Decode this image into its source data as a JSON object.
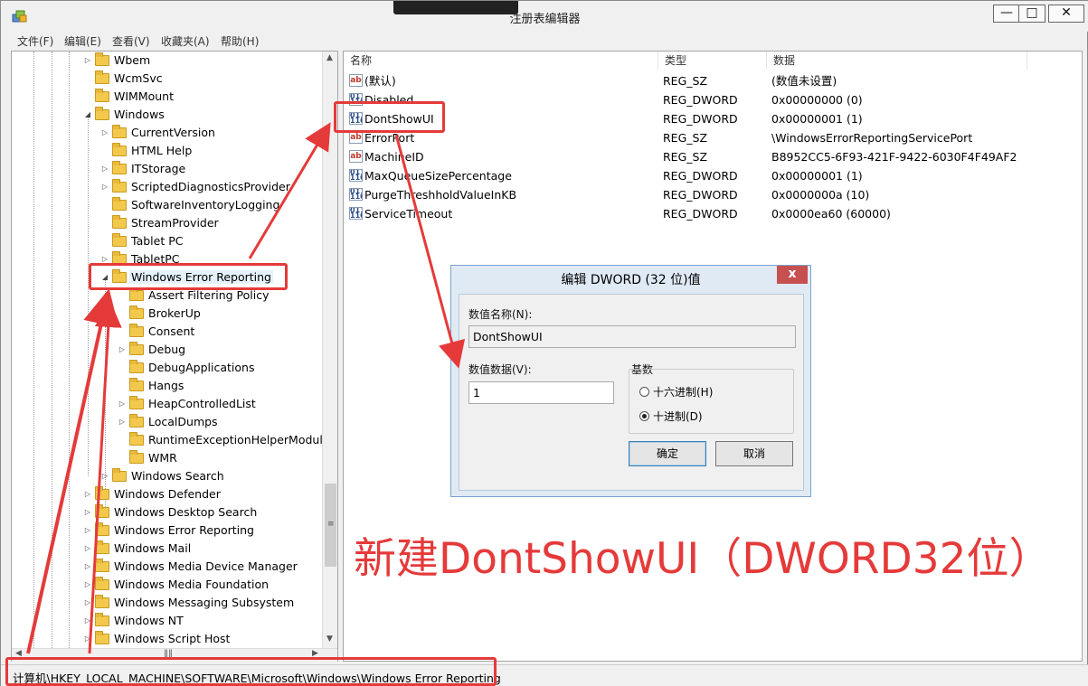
{
  "window": {
    "title": "注册表编辑器"
  },
  "menu": [
    "文件(F)",
    "编辑(E)",
    "查看(V)",
    "收藏夹(A)",
    "帮助(H)"
  ],
  "tree": [
    {
      "label": "Wbem",
      "depth": 1,
      "expander": "collapsed"
    },
    {
      "label": "WcmSvc",
      "depth": 1,
      "expander": "none"
    },
    {
      "label": "WIMMount",
      "depth": 1,
      "expander": "none"
    },
    {
      "label": "Windows",
      "depth": 1,
      "expander": "expanded"
    },
    {
      "label": "CurrentVersion",
      "depth": 2,
      "expander": "collapsed"
    },
    {
      "label": "HTML Help",
      "depth": 2,
      "expander": "none"
    },
    {
      "label": "ITStorage",
      "depth": 2,
      "expander": "collapsed"
    },
    {
      "label": "ScriptedDiagnosticsProvider",
      "depth": 2,
      "expander": "collapsed"
    },
    {
      "label": "SoftwareInventoryLogging",
      "depth": 2,
      "expander": "none"
    },
    {
      "label": "StreamProvider",
      "depth": 2,
      "expander": "none"
    },
    {
      "label": "Tablet PC",
      "depth": 2,
      "expander": "none"
    },
    {
      "label": "TabletPC",
      "depth": 2,
      "expander": "collapsed"
    },
    {
      "label": "Windows Error Reporting",
      "depth": 2,
      "expander": "expanded",
      "selected": true
    },
    {
      "label": "Assert Filtering Policy",
      "depth": 3,
      "expander": "none"
    },
    {
      "label": "BrokerUp",
      "depth": 3,
      "expander": "none"
    },
    {
      "label": "Consent",
      "depth": 3,
      "expander": "none"
    },
    {
      "label": "Debug",
      "depth": 3,
      "expander": "collapsed"
    },
    {
      "label": "DebugApplications",
      "depth": 3,
      "expander": "none"
    },
    {
      "label": "Hangs",
      "depth": 3,
      "expander": "none"
    },
    {
      "label": "HeapControlledList",
      "depth": 3,
      "expander": "collapsed"
    },
    {
      "label": "LocalDumps",
      "depth": 3,
      "expander": "collapsed"
    },
    {
      "label": "RuntimeExceptionHelperModules",
      "depth": 3,
      "expander": "none"
    },
    {
      "label": "WMR",
      "depth": 3,
      "expander": "none"
    },
    {
      "label": "Windows Search",
      "depth": 2,
      "expander": "collapsed"
    },
    {
      "label": "Windows Defender",
      "depth": 1,
      "expander": "collapsed"
    },
    {
      "label": "Windows Desktop Search",
      "depth": 1,
      "expander": "collapsed"
    },
    {
      "label": "Windows Error Reporting",
      "depth": 1,
      "expander": "collapsed"
    },
    {
      "label": "Windows Mail",
      "depth": 1,
      "expander": "collapsed"
    },
    {
      "label": "Windows Media Device Manager",
      "depth": 1,
      "expander": "collapsed"
    },
    {
      "label": "Windows Media Foundation",
      "depth": 1,
      "expander": "collapsed"
    },
    {
      "label": "Windows Messaging Subsystem",
      "depth": 1,
      "expander": "collapsed"
    },
    {
      "label": "Windows NT",
      "depth": 1,
      "expander": "collapsed"
    },
    {
      "label": "Windows Script Host",
      "depth": 1,
      "expander": "collapsed"
    }
  ],
  "columns": {
    "name": "名称",
    "type": "类型",
    "data": "数据"
  },
  "values": [
    {
      "icon": "ab",
      "name": "(默认)",
      "type": "REG_SZ",
      "data": "(数值未设置)"
    },
    {
      "icon": "bin",
      "name": "Disabled",
      "type": "REG_DWORD",
      "data": "0x00000000 (0)"
    },
    {
      "icon": "bin",
      "name": "DontShowUI",
      "type": "REG_DWORD",
      "data": "0x00000001 (1)"
    },
    {
      "icon": "ab",
      "name": "ErrorPort",
      "type": "REG_SZ",
      "data": "\\WindowsErrorReportingServicePort"
    },
    {
      "icon": "ab",
      "name": "MachineID",
      "type": "REG_SZ",
      "data": "B8952CC5-6F93-421F-9422-6030F4F49AF2"
    },
    {
      "icon": "bin",
      "name": "MaxQueueSizePercentage",
      "type": "REG_DWORD",
      "data": "0x00000001 (1)"
    },
    {
      "icon": "bin",
      "name": "PurgeThreshholdValueInKB",
      "type": "REG_DWORD",
      "data": "0x0000000a (10)"
    },
    {
      "icon": "bin",
      "name": "ServiceTimeout",
      "type": "REG_DWORD",
      "data": "0x0000ea60 (60000)"
    }
  ],
  "status": {
    "path": "计算机\\HKEY_LOCAL_MACHINE\\SOFTWARE\\Microsoft\\Windows\\Windows Error Reporting"
  },
  "dialog": {
    "title": "编辑 DWORD (32 位)值",
    "close": "x",
    "name_label": "数值名称(N):",
    "name_value": "DontShowUI",
    "data_label": "数值数据(V):",
    "data_value": "1",
    "base_label": "基数",
    "hex_label": "十六进制(H)",
    "dec_label": "十进制(D)",
    "base_selected": "dec",
    "ok": "确定",
    "cancel": "取消"
  },
  "annotation": {
    "text": "新建DontShowUI（DWORD32位）"
  },
  "colors": {
    "annotation": "#e53a3a",
    "selection": "#e5f1fb",
    "folder": "#f2c94c"
  }
}
